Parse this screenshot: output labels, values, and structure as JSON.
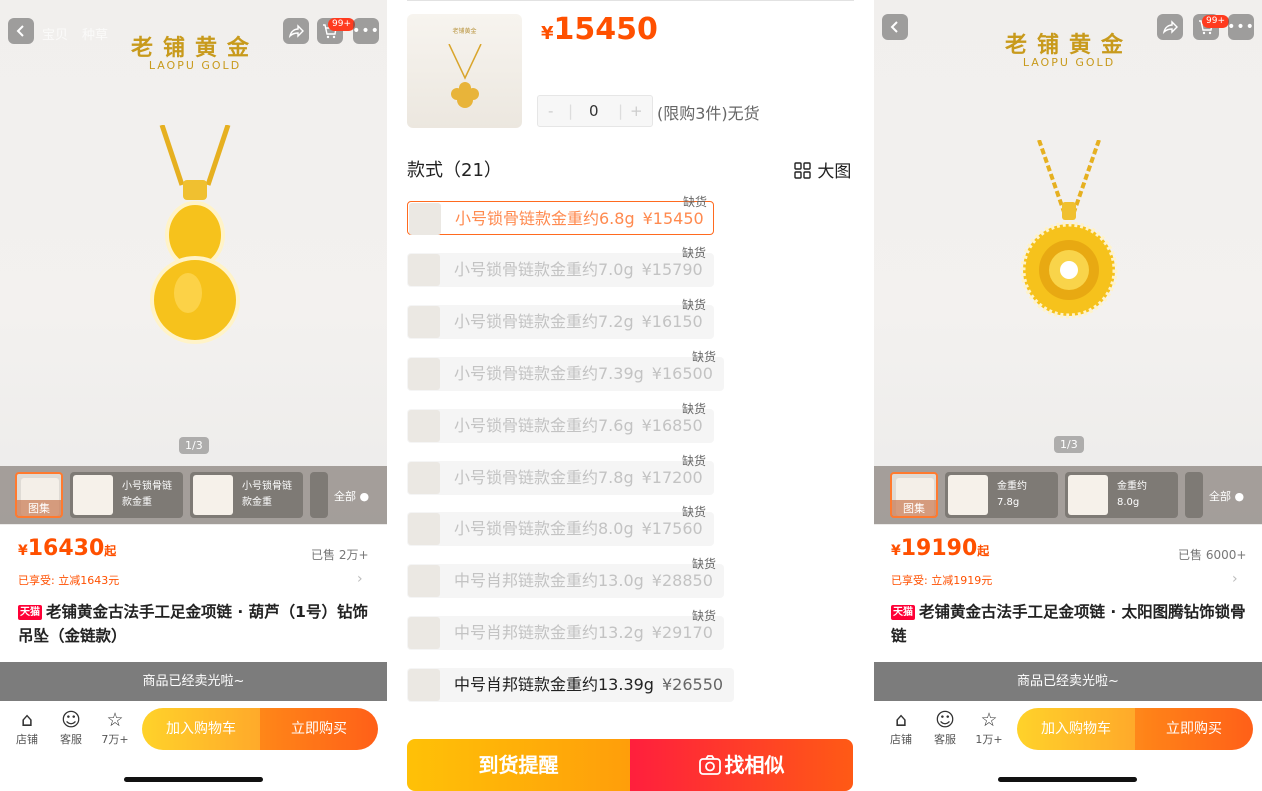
{
  "left": {
    "faded_tabs": [
      "宝贝",
      "种草"
    ],
    "cart_badge": "99+",
    "brand": "老铺黄金",
    "brand_en": "LAOPU GOLD",
    "pager": "1/3",
    "thumbs": [
      {
        "tag": "图集"
      },
      {
        "label": "小号锁骨链款金重"
      },
      {
        "label": "小号锁骨链款金重"
      }
    ],
    "all_label": "全部",
    "price_symbol": "¥",
    "price": "16430",
    "price_suffix": "起",
    "sold": "已售 2万+",
    "savings": "已享受: 立减1643元",
    "tmall": "天猫",
    "title": "老铺黄金古法手工足金项链 · 葫芦（1号）钻饰吊坠（金链款）",
    "soldout_banner": "商品已经卖光啦~",
    "bottom_icons": [
      {
        "icon": "store-icon",
        "label": "店铺"
      },
      {
        "icon": "service-icon",
        "label": "客服"
      },
      {
        "icon": "star-icon",
        "label": "7万+"
      }
    ],
    "add_cart": "加入购物车",
    "buy_now": "立即购买"
  },
  "middle": {
    "price_symbol": "¥",
    "price": "15450",
    "stepper": {
      "minus": "-",
      "value": "0",
      "plus": "+"
    },
    "limit_text": "(限购3件)无货",
    "section_title": "款式（21）",
    "big_image": "大图",
    "options": [
      {
        "name": "小号锁骨链款金重约6.8g",
        "price": "¥15450",
        "status": "缺货",
        "selected": true
      },
      {
        "name": "小号锁骨链款金重约7.0g",
        "price": "¥15790",
        "status": "缺货"
      },
      {
        "name": "小号锁骨链款金重约7.2g",
        "price": "¥16150",
        "status": "缺货"
      },
      {
        "name": "小号锁骨链款金重约7.39g",
        "price": "¥16500",
        "status": "缺货"
      },
      {
        "name": "小号锁骨链款金重约7.6g",
        "price": "¥16850",
        "status": "缺货"
      },
      {
        "name": "小号锁骨链款金重约7.8g",
        "price": "¥17200",
        "status": "缺货"
      },
      {
        "name": "小号锁骨链款金重约8.0g",
        "price": "¥17560",
        "status": "缺货"
      },
      {
        "name": "中号肖邦链款金重约13.0g",
        "price": "¥28850",
        "status": "缺货"
      },
      {
        "name": "中号肖邦链款金重约13.2g",
        "price": "¥29170",
        "status": "缺货"
      },
      {
        "name": "中号肖邦链款金重约13.39g",
        "price": "¥26550",
        "status": "",
        "available": true
      }
    ],
    "remind_button": "到货提醒",
    "similar_button": "找相似"
  },
  "right": {
    "cart_badge": "99+",
    "brand": "老铺黄金",
    "brand_en": "LAOPU GOLD",
    "pager": "1/3",
    "thumbs": [
      {
        "tag": "图集"
      },
      {
        "label": "金重约7.8g"
      },
      {
        "label": "金重约8.0g"
      }
    ],
    "all_label": "全部",
    "price_symbol": "¥",
    "price": "19190",
    "price_suffix": "起",
    "sold": "已售 6000+",
    "savings": "已享受: 立减1919元",
    "tmall": "天猫",
    "title": "老铺黄金古法手工足金项链 · 太阳图腾钻饰锁骨链",
    "soldout_banner": "商品已经卖光啦~",
    "bottom_icons": [
      {
        "icon": "store-icon",
        "label": "店铺"
      },
      {
        "icon": "service-icon",
        "label": "客服"
      },
      {
        "icon": "star-icon",
        "label": "1万+"
      }
    ],
    "add_cart": "加入购物车",
    "buy_now": "立即购买"
  },
  "colors": {
    "accent": "#ff5000",
    "gold": "#c89a1c",
    "tmall_red": "#ff0036"
  }
}
